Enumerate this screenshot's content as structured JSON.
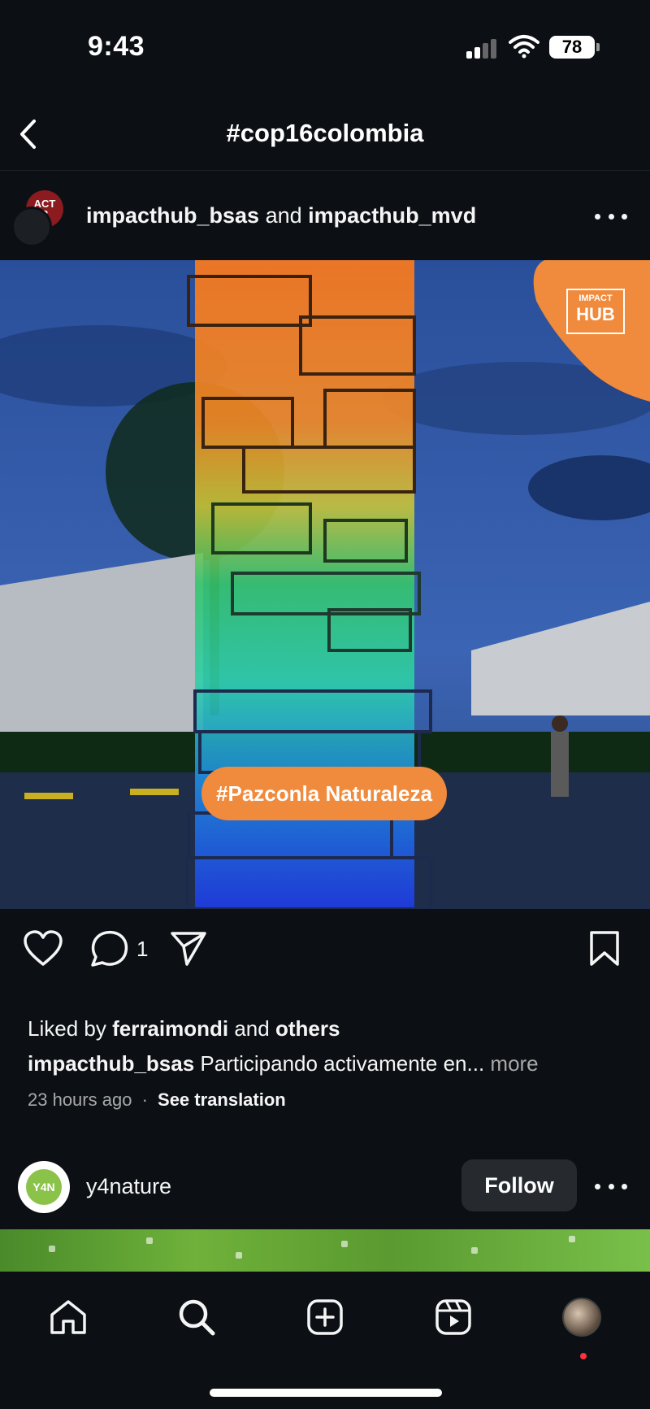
{
  "status_bar": {
    "time": "9:43",
    "battery": "78"
  },
  "header": {
    "title": "#cop16colombia"
  },
  "post": {
    "owner_primary": "impacthub_bsas",
    "owner_joiner": "and",
    "owner_secondary": "impacthub_mvd",
    "avatar_badge": "ACT\nB",
    "image": {
      "brand_logo_line1": "IMPACT",
      "brand_logo_line2": "HUB",
      "hashtag_overlay": "#Pazconla Naturaleza"
    },
    "comment_count": "1",
    "likes": {
      "prefix": "Liked by",
      "user": "ferraimondi",
      "joiner": "and",
      "suffix": "others"
    },
    "caption": {
      "username": "impacthub_bsas",
      "text": "Participando activamente en...",
      "more": "more"
    },
    "timestamp": "23 hours ago",
    "separator": "·",
    "see_translation": "See translation"
  },
  "next_post": {
    "avatar_text": "Y4N",
    "username": "y4nature",
    "follow_label": "Follow"
  },
  "icons": {
    "back": "chevron-left-icon",
    "more": "more-horizontal-icon",
    "like": "heart-icon",
    "comment": "comment-icon",
    "share": "send-icon",
    "save": "bookmark-icon",
    "home": "home-icon",
    "search": "search-icon",
    "create": "plus-square-icon",
    "reels": "reels-icon"
  },
  "colors": {
    "background": "#0c1014",
    "accent_orange": "#f08a3c",
    "notification_red": "#ff3040"
  }
}
